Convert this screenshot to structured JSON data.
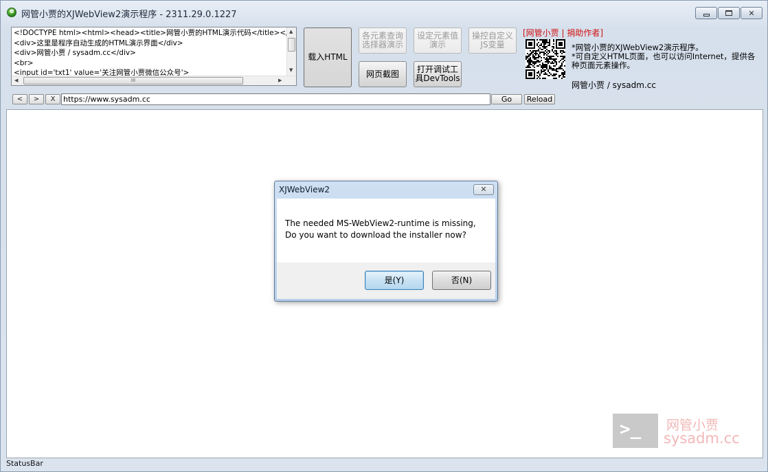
{
  "window": {
    "title": "网管小贾的XJWebView2演示程序 - 2311.29.0.1227",
    "controls": {
      "minimize": "minimize-icon",
      "maximize": "maximize-icon",
      "close": "✕"
    }
  },
  "editor": {
    "lines": [
      "<!DOCTYPE html><html><head><title>网管小贾的HTML演示代码</title></head>",
      "<div>这里是程序自动生成的HTML演示界面</div>",
      "<div>网管小贾 / sysadm.cc</div>",
      "<br>",
      "<input id='txt1' value='关注网管小贾微信公众号'>"
    ],
    "hscroll_grip": "III"
  },
  "toolbar": {
    "load_html": "载入HTML",
    "query_selector_1": "各元素查询",
    "query_selector_2": "选择器演示",
    "set_value_1": "设定元素值",
    "set_value_2": "演示",
    "custom_js_1": "操控自定义",
    "custom_js_2": "JS变量",
    "screenshot": "网页截图",
    "devtools_1": "打开调试工",
    "devtools_2": "具DevTools"
  },
  "sponsor": {
    "link": "[网管小贾 | 捐助作者]",
    "info_1": "*网管小贾的XJWebView2演示程序。",
    "info_2": "*可自定义HTML页面，也可以访问Internet，提供各种页面元素操作。",
    "site": "网管小贾 / sysadm.cc"
  },
  "nav": {
    "back": "<",
    "forward": ">",
    "stop": "X",
    "url": "https://www.sysadm.cc",
    "go": "Go",
    "reload": "Reload"
  },
  "watermark": {
    "glyph": ">_",
    "name": "网管小贾",
    "domain": "sysadm.cc"
  },
  "dialog": {
    "title": "XJWebView2",
    "close": "✕",
    "message_1": "The needed MS-WebView2-runtime is missing,",
    "message_2": "Do you want to download the installer now?",
    "yes": "是(Y)",
    "no": "否(N)"
  },
  "statusbar": {
    "text": "StatusBar"
  }
}
